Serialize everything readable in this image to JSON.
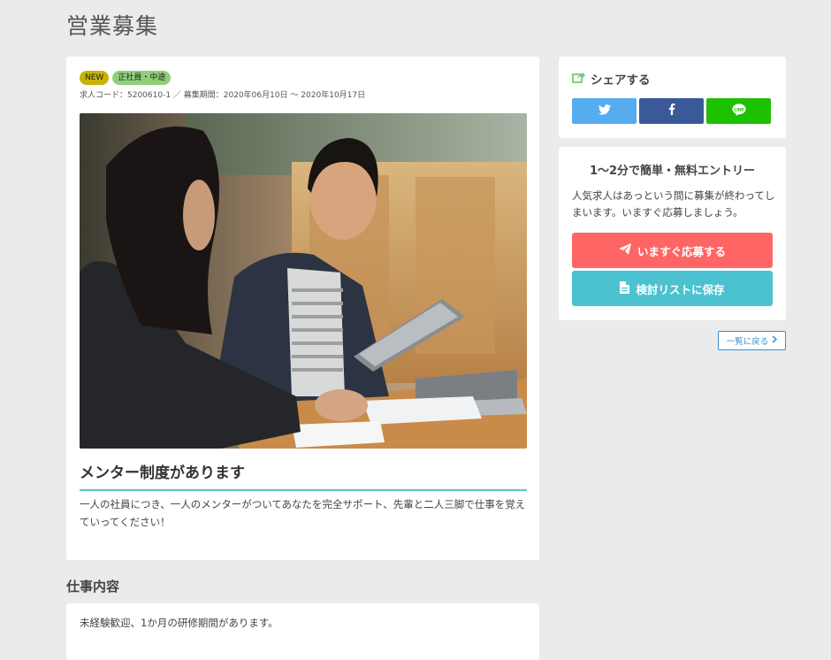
{
  "page": {
    "title": "営業募集"
  },
  "job": {
    "tags": [
      "NEW",
      "正社員・中途"
    ],
    "meta": "求人コード：5200610-1 ／ 募集期間：2020年06月10日 〜 2020年10月17日",
    "photo_icon": "office-meeting-photo",
    "heading": "メンター制度があります",
    "text": "一人の社員につき、一人のメンターがついてあなたを完全サポート、先輩と二人三脚で仕事を覚えていってください！"
  },
  "work": {
    "title": "仕事内容",
    "text": "未経験歓迎、1か月の研修期間があります。"
  },
  "share": {
    "title": "シェアする",
    "icons": [
      "share-icon",
      "twitter-icon",
      "facebook-icon",
      "line-icon"
    ]
  },
  "entry": {
    "title": "1〜2分で簡単・無料エントリー",
    "desc": "人気求人はあっという間に募集が終わってしまいます。いますぐ応募しましょう。",
    "apply_label": "いますぐ応募する",
    "save_label": "検討リストに保存"
  },
  "back": {
    "label": "一覧に戻る"
  },
  "colors": {
    "accent_underline": "#5bc7c4",
    "apply": "#ff6565",
    "save": "#4cc2d0",
    "twitter": "#55acee",
    "facebook": "#3b5998",
    "line": "#1dc100",
    "tag_new": "#c8b300",
    "tag_type": "#8ed07a"
  }
}
